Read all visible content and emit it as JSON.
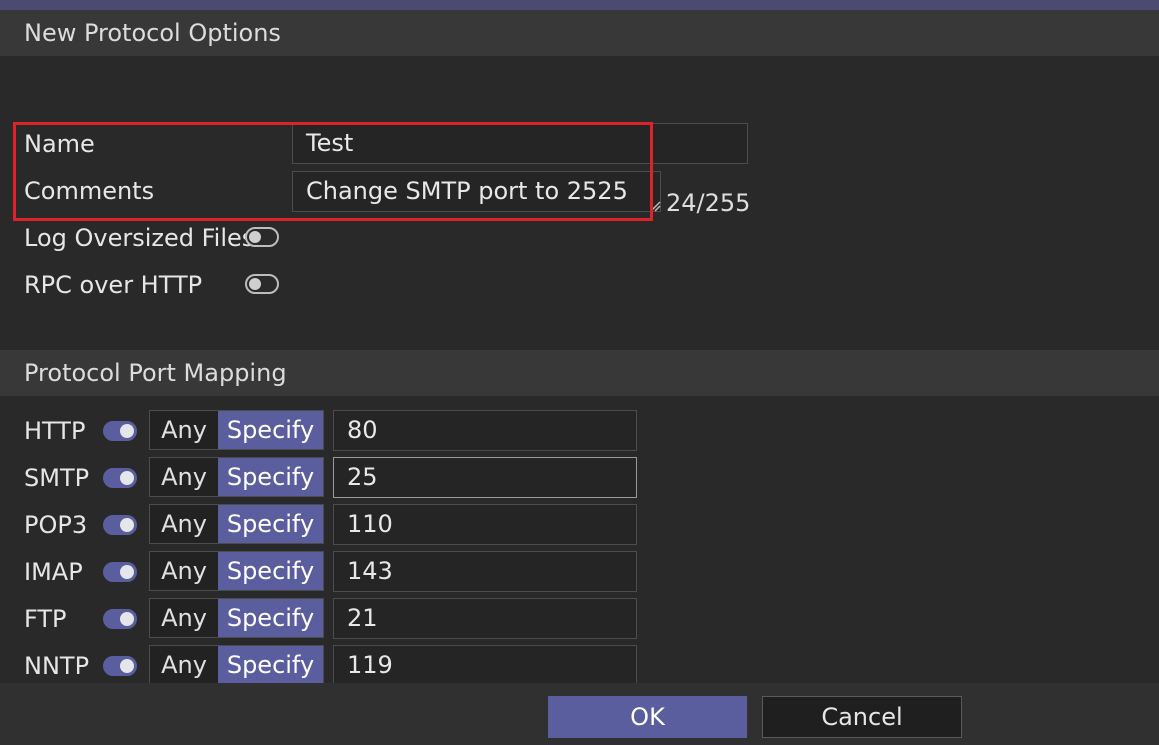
{
  "dialog": {
    "section1_title": "New Protocol Options",
    "section2_title": "Protocol Port Mapping"
  },
  "form": {
    "name_label": "Name",
    "name_value": "Test",
    "comments_label": "Comments",
    "comments_value": "Change SMTP port to 2525",
    "comments_counter": "24/255",
    "log_oversized_label": "Log Oversized Files",
    "log_oversized_enabled": false,
    "rpc_over_http_label": "RPC over HTTP",
    "rpc_over_http_enabled": false
  },
  "ports": [
    {
      "protocol": "HTTP",
      "enabled": true,
      "any_label": "Any",
      "specify_label": "Specify",
      "selected": "Specify",
      "port": "80"
    },
    {
      "protocol": "SMTP",
      "enabled": true,
      "any_label": "Any",
      "specify_label": "Specify",
      "selected": "Specify",
      "port": "25"
    },
    {
      "protocol": "POP3",
      "enabled": true,
      "any_label": "Any",
      "specify_label": "Specify",
      "selected": "Specify",
      "port": "110"
    },
    {
      "protocol": "IMAP",
      "enabled": true,
      "any_label": "Any",
      "specify_label": "Specify",
      "selected": "Specify",
      "port": "143"
    },
    {
      "protocol": "FTP",
      "enabled": true,
      "any_label": "Any",
      "specify_label": "Specify",
      "selected": "Specify",
      "port": "21"
    },
    {
      "protocol": "NNTP",
      "enabled": true,
      "any_label": "Any",
      "specify_label": "Specify",
      "selected": "Specify",
      "port": "119"
    }
  ],
  "buttons": {
    "ok_label": "OK",
    "cancel_label": "Cancel"
  },
  "colors": {
    "accent": "#5b5e9e",
    "highlight_box": "#e0212b"
  }
}
